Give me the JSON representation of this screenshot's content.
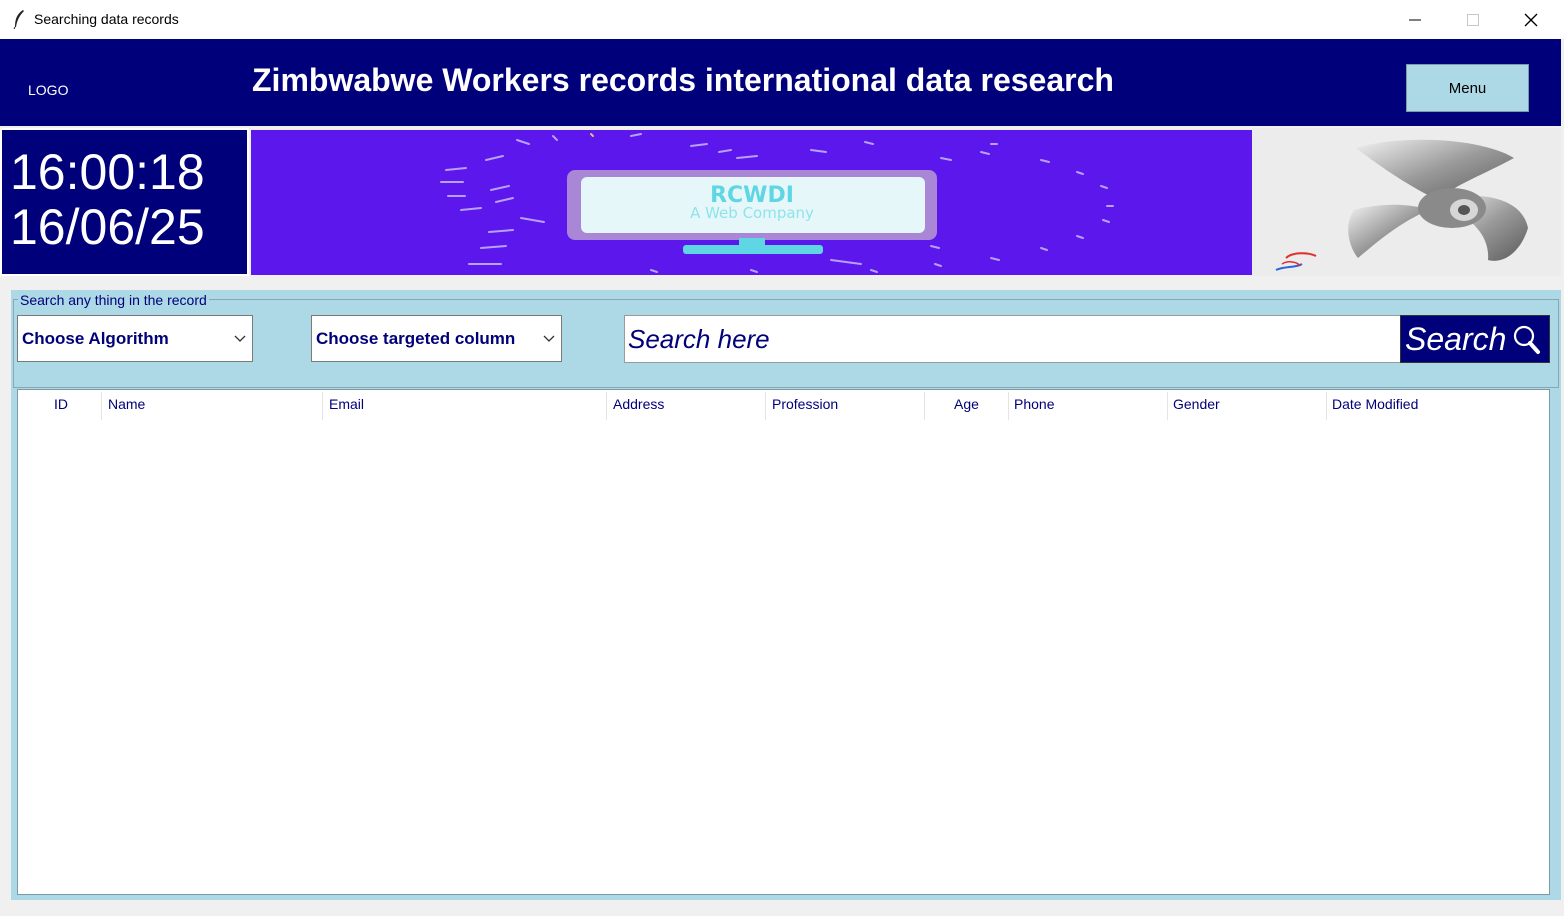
{
  "window": {
    "title": "Searching data records",
    "controls": [
      "minimize-icon",
      "maximize-icon",
      "close-icon"
    ]
  },
  "header": {
    "logo": "LOGO",
    "title": "Zimbwabwe Workers records international data research",
    "menu_label": "Menu",
    "background": "#00007a"
  },
  "clock": {
    "time": "16:00:18",
    "date": "16/06/25"
  },
  "banner": {
    "title": "RCWDI",
    "subtitle": "A Web Company",
    "background": "#5b17ec",
    "accent": "#5fd6e4"
  },
  "search": {
    "legend": "Search any thing in the record",
    "algorithm_select": "Choose Algorithm",
    "column_select": "Choose targeted column",
    "placeholder": "Search here",
    "button_label": "Search",
    "panel_color": "#add8e6"
  },
  "table": {
    "columns": [
      "ID",
      "Name",
      "Email",
      "Address",
      "Profession",
      "Age",
      "Phone",
      "Gender",
      "Date Modified"
    ],
    "rows": []
  }
}
